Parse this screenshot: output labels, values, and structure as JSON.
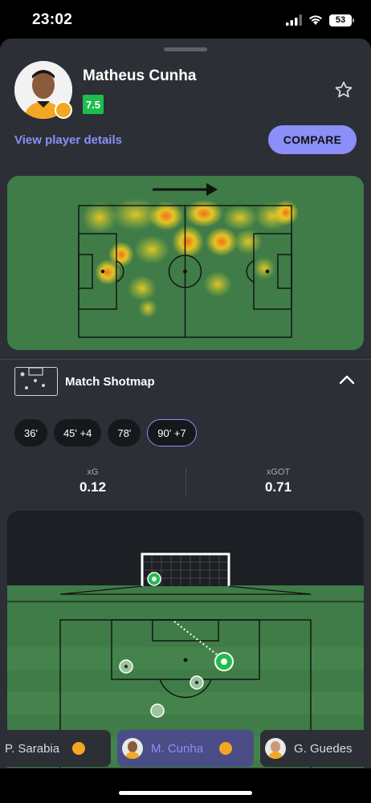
{
  "status_bar": {
    "time": "23:02",
    "battery": "53"
  },
  "player": {
    "name": "Matheus Cunha",
    "rating": "7.5",
    "details_link": "View player details",
    "compare_label": "COMPARE"
  },
  "shotmap": {
    "title": "Match Shotmap",
    "shots": [
      "36'",
      "45' +4",
      "78'",
      "90' +7"
    ],
    "selected_shot": "90' +7",
    "xg_label": "xG",
    "xg_value": "0.12",
    "xgot_label": "xGOT",
    "xgot_value": "0.71"
  },
  "player_tabs": [
    {
      "name": "P. Sarabia",
      "active": false
    },
    {
      "name": "M. Cunha",
      "active": true
    },
    {
      "name": "G. Guedes",
      "active": false
    }
  ],
  "colors": {
    "accent": "#8b8ff7",
    "rating_green": "#1fbd4e",
    "pitch_green": "#3f7c47",
    "sheet_bg": "#2c2f36"
  },
  "icons": {
    "star": "star-icon",
    "chevron": "chevron-up-icon",
    "direction": "attack-direction-arrow",
    "shotmap": "shotmap-icon",
    "club": "wolves-badge-icon"
  }
}
